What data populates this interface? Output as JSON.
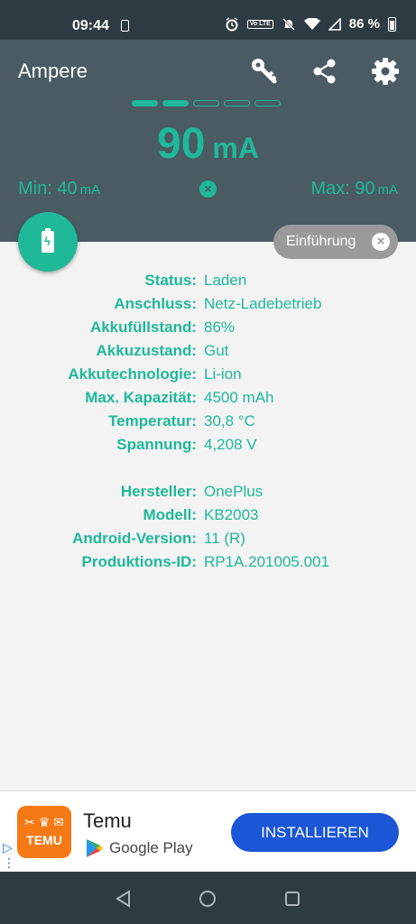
{
  "statusbar": {
    "time": "09:44",
    "volte": "Vo LTE",
    "battery": "86 %"
  },
  "app": {
    "title": "Ampere"
  },
  "icons": {
    "key": "key-icon",
    "share": "share-icon",
    "settings": "gear-icon",
    "fab": "battery-charging-icon"
  },
  "colors": {
    "accent": "#1fb899",
    "header": "#4a5b63",
    "button": "#1a56d6",
    "temu": "#f57a16"
  },
  "measure": {
    "value": "90",
    "unit": "mA",
    "min_label": "Min: 40",
    "min_unit": "mA",
    "max_label": "Max: 90",
    "max_unit": "mA",
    "page_dots_total": 5,
    "page_dots_active": 2
  },
  "intro": {
    "label": "Einführung"
  },
  "info1": [
    {
      "k": "Status:",
      "v": "Laden"
    },
    {
      "k": "Anschluss:",
      "v": "Netz-Ladebetrieb"
    },
    {
      "k": "Akkufüllstand:",
      "v": "86%"
    },
    {
      "k": "Akkuzustand:",
      "v": "Gut"
    },
    {
      "k": "Akkutechnologie:",
      "v": "Li-ion"
    },
    {
      "k": "Max. Kapazität:",
      "v": "4500 mAh"
    },
    {
      "k": "Temperatur:",
      "v": "30,8 °C"
    },
    {
      "k": "Spannung:",
      "v": "4,208 V"
    }
  ],
  "info2": [
    {
      "k": "Hersteller:",
      "v": "OnePlus"
    },
    {
      "k": "Modell:",
      "v": "KB2003"
    },
    {
      "k": "Android-Version:",
      "v": "11 (R)"
    },
    {
      "k": "Produktions-ID:",
      "v": "RP1A.201005.001"
    }
  ],
  "ad": {
    "logo_text": "TEMU",
    "title": "Temu",
    "store": "Google Play",
    "cta": "INSTALLIEREN"
  }
}
